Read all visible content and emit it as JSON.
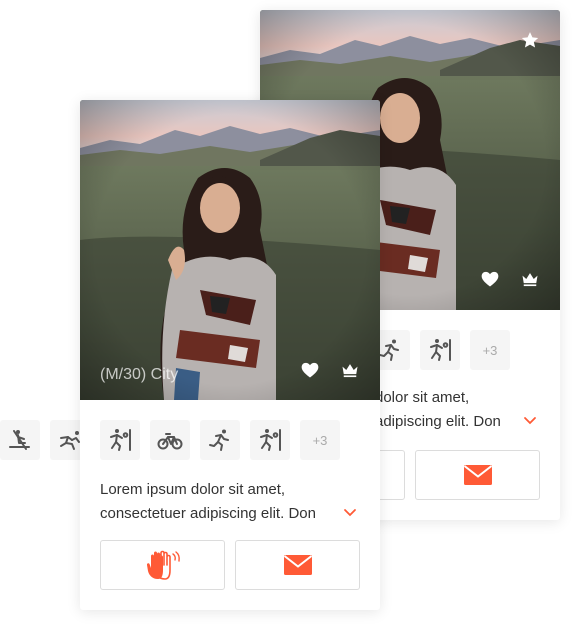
{
  "cards": {
    "back": {
      "visible_activities": [
        "running-icon",
        "soccer-icon"
      ],
      "more_count": "+3",
      "description_line1": "dolor sit amet,",
      "description_line2": "adipiscing elit. Don",
      "icons": [
        "star-icon",
        "heart-icon",
        "crown-icon",
        "mail-icon"
      ]
    },
    "front": {
      "caption": "(M/30) City",
      "activities": [
        "rowing-icon",
        "bowling-icon",
        "soccer-icon",
        "cycling-icon",
        "running-icon",
        "soccer-icon"
      ],
      "more_count": "+3",
      "description_line1": "Lorem ipsum dolor sit amet,",
      "description_line2": "consectetuer adipiscing elit. Don",
      "icons": [
        "heart-icon",
        "crown-icon",
        "wave-hands-icon",
        "mail-icon",
        "chevron-down-icon"
      ]
    }
  },
  "colors": {
    "accent": "#ff5a36",
    "icon_gray": "#555555",
    "tile_bg": "#f5f5f5",
    "border": "#dcdcdc"
  }
}
